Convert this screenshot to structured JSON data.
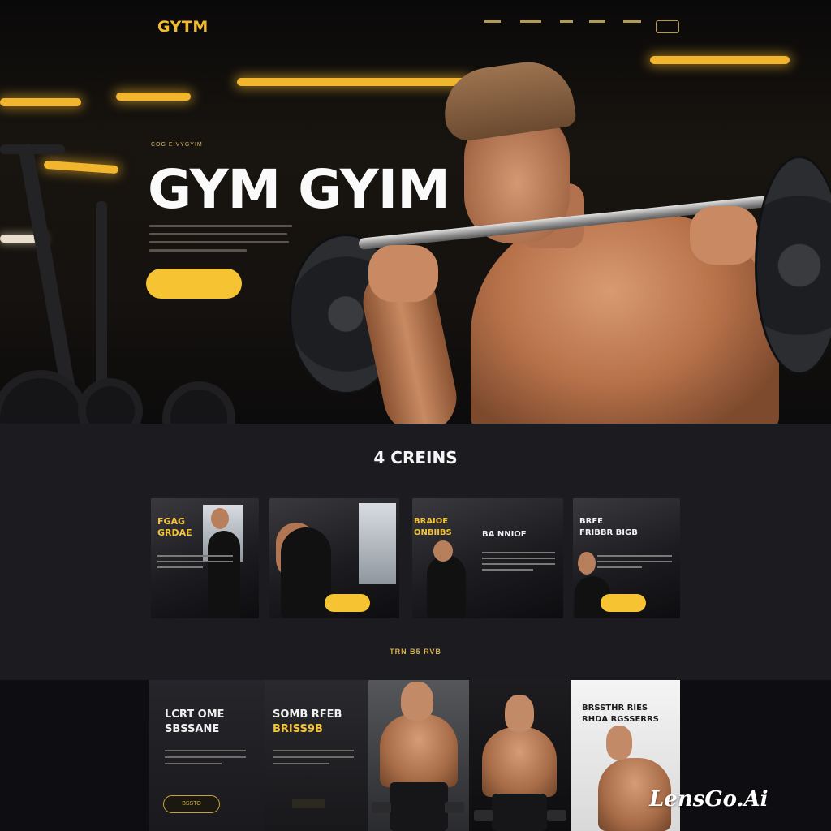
{
  "header": {
    "logo": "GYTM",
    "nav": [
      "",
      "",
      "",
      "",
      ""
    ],
    "nav_button": ""
  },
  "hero": {
    "eyebrow": "COG EIVYGYIM",
    "title": "GYM GYIM",
    "cta_label": ""
  },
  "classes": {
    "title": "4 CREINS",
    "cards": [
      {
        "title": "FGAG\nGRDAE",
        "button": ""
      },
      {
        "title": "",
        "button": ""
      },
      {
        "title": "BRAIOE\nONBIIBS",
        "button": ""
      },
      {
        "title": "BRFE\nFRIBBR BIGB",
        "button": ""
      }
    ],
    "card3_subtitle": "BA NNIOF",
    "subtitle": "TRN B5 RVB"
  },
  "trainers": {
    "cards": [
      {
        "title_line1": "LCRT OME",
        "title_line2": "SBSSANE",
        "button": "BSSTO"
      },
      {
        "title_line1": "SOMB RFEB",
        "title_line2": "BRISS9B",
        "badge": ""
      },
      {
        "title": ""
      },
      {
        "title": ""
      },
      {
        "title_line1": "BRSSTHR RIES",
        "title_line2": "RHDA RGSSERRS"
      }
    ]
  },
  "watermark": "LensGo.Ai",
  "colors": {
    "accent": "#f6c332",
    "background_dark": "#141316",
    "section_bg": "#1c1b20"
  }
}
